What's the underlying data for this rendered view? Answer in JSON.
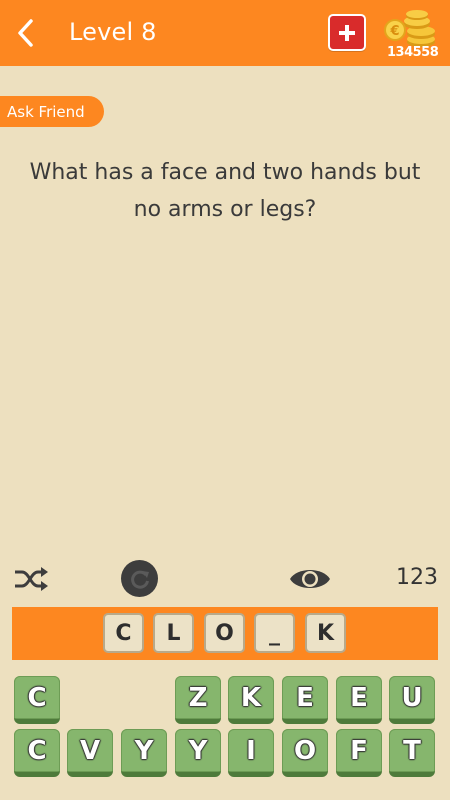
{
  "header": {
    "level_label": "Level 8",
    "plus_label": "+",
    "coins": "134558"
  },
  "ask_friend_label": "Ask Friend",
  "question": "What has a face and two hands but no arms or legs?",
  "hint_count": "123",
  "answer_slots": [
    "C",
    "L",
    "O",
    "_",
    "K"
  ],
  "keyboard": {
    "row1": [
      "C",
      "Z",
      "K",
      "E",
      "E",
      "U"
    ],
    "row2": [
      "C",
      "V",
      "Y",
      "Y",
      "I",
      "O",
      "F",
      "T"
    ]
  },
  "colors": {
    "accent": "#fd8720",
    "background": "#ede0bf",
    "tile_green": "#86b66d",
    "plus_red": "#d92b2b"
  }
}
